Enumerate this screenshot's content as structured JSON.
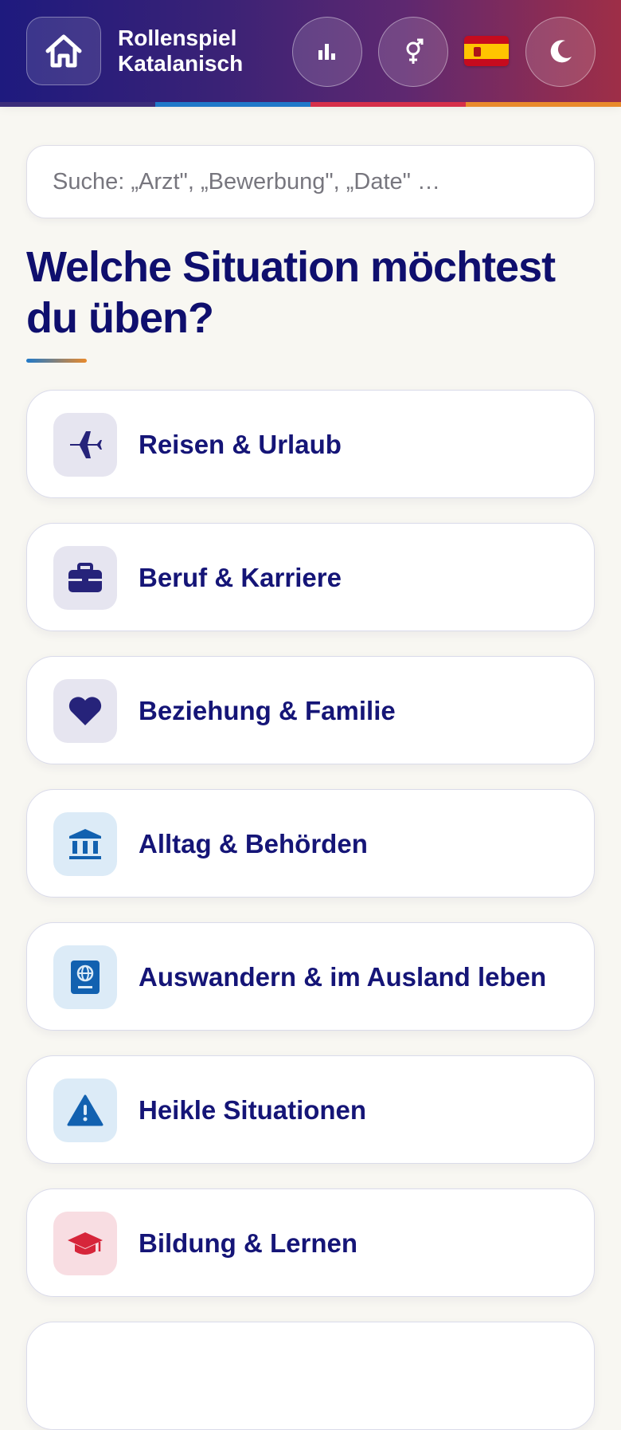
{
  "header": {
    "title_line1": "Rollenspiel",
    "title_line2": "Katalanisch",
    "home_icon": "home-icon",
    "stats_icon": "bar-chart-icon",
    "gender_icon": "gender-icon",
    "flag_icon": "spain-flag-icon",
    "theme_icon": "moon-icon"
  },
  "search": {
    "placeholder": "Suche: „Arzt\", „Bewerbung\", „Date\" …"
  },
  "main": {
    "heading": "Welche Situation möchtest du üben?",
    "categories": [
      {
        "label": "Reisen & Urlaub",
        "icon": "plane-icon"
      },
      {
        "label": "Beruf & Karriere",
        "icon": "briefcase-icon"
      },
      {
        "label": "Beziehung & Familie",
        "icon": "heart-icon"
      },
      {
        "label": "Alltag & Behörden",
        "icon": "building-icon"
      },
      {
        "label": "Auswandern & im Ausland leben",
        "icon": "passport-icon"
      },
      {
        "label": "Heikle Situationen",
        "icon": "warning-icon"
      },
      {
        "label": "Bildung & Lernen",
        "icon": "graduation-cap-icon"
      }
    ]
  },
  "colors": {
    "heading": "#0f0f6e",
    "category_violet": "#26237a",
    "category_blue": "#1261b0",
    "category_red": "#d6253a"
  }
}
